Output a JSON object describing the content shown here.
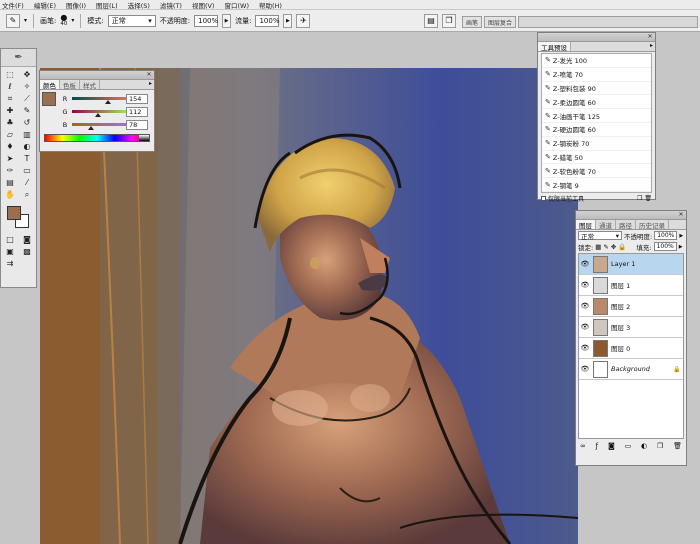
{
  "menu": [
    "文件(F)",
    "编辑(E)",
    "图像(I)",
    "图层(L)",
    "选择(S)",
    "滤镜(T)",
    "视图(V)",
    "窗口(W)",
    "帮助(H)"
  ],
  "options": {
    "brush_label": "画笔:",
    "brush_size": "40",
    "mode_label": "模式:",
    "mode_value": "正常",
    "opacity_label": "不透明度:",
    "opacity_value": "100%",
    "flow_label": "流量:",
    "flow_value": "100%"
  },
  "well_tabs": [
    "画笔",
    "图层复合"
  ],
  "color_panel": {
    "tabs": [
      "颜色",
      "色板",
      "样式"
    ],
    "r_label": "R",
    "r_value": "154",
    "r_fraction": 0.6,
    "g_label": "G",
    "g_value": "112",
    "g_fraction": 0.44,
    "b_label": "B",
    "b_value": "78",
    "b_fraction": 0.31,
    "swatch_color": "#9a704e"
  },
  "tool_presets": {
    "title": "工具预设",
    "items": [
      "Z-发光 100",
      "Z-喷笔 70",
      "Z-塑料包装 90",
      "Z-柔边圆笔 60",
      "Z-油画干笔 125",
      "Z-硬边圆笔 60",
      "Z-钢炭粉 70",
      "Z-蜡笔 50",
      "Z-软色粉笔 70",
      "Z-钢笔 9"
    ],
    "footer_label": "仅限当前工具"
  },
  "layers_panel": {
    "tabs": [
      "图层",
      "通道",
      "路径",
      "历史记录"
    ],
    "blend_mode": "正常",
    "opacity_label": "不透明度:",
    "opacity_value": "100%",
    "lock_label": "锁定:",
    "fill_label": "填充:",
    "fill_value": "100%",
    "layers": [
      {
        "name": "Layer 1",
        "selected": true,
        "thumb": "#c9a98e"
      },
      {
        "name": "图层 1",
        "selected": false,
        "thumb": "#d9d9d9"
      },
      {
        "name": "图层 2",
        "selected": false,
        "thumb": "#b88a6a"
      },
      {
        "name": "图层 3",
        "selected": false,
        "thumb": "#cfc6c0"
      },
      {
        "name": "图层 0",
        "selected": false,
        "thumb": "#8c5a2e"
      },
      {
        "name": "Background",
        "selected": false,
        "thumb": "#ffffff",
        "locked": true
      }
    ]
  },
  "colors": {
    "fg_color": "#9a6e4e",
    "bg_color": "#ffffff",
    "selected_layer": "#b9d6ef"
  }
}
